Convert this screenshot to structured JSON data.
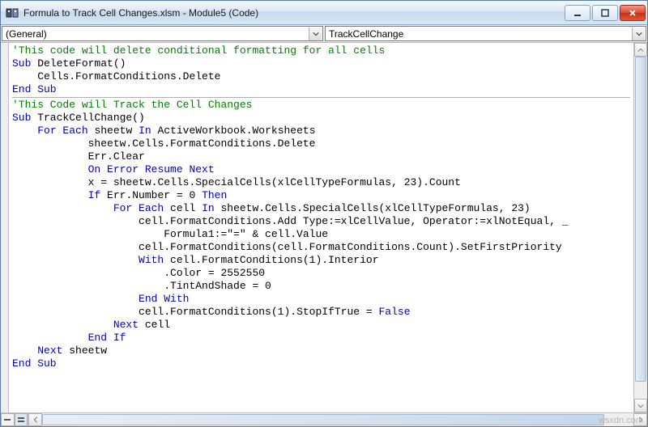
{
  "window": {
    "title": "Formula to Track Cell Changes.xlsm - Module5 (Code)"
  },
  "dropdowns": {
    "left": "(General)",
    "right": "TrackCellChange"
  },
  "code": {
    "lines": [
      {
        "indent": 0,
        "segs": [
          {
            "t": "'This code will delete conditional formatting for all cells",
            "c": "c-comment"
          }
        ]
      },
      {
        "indent": 0,
        "segs": [
          {
            "t": "Sub",
            "c": "c-keyword"
          },
          {
            "t": " DeleteFormat()"
          }
        ]
      },
      {
        "indent": 1,
        "segs": [
          {
            "t": "Cells.FormatConditions.Delete"
          }
        ]
      },
      {
        "indent": 0,
        "segs": [
          {
            "t": "End Sub",
            "c": "c-keyword"
          }
        ]
      },
      {
        "rule": true
      },
      {
        "indent": 0,
        "segs": [
          {
            "t": "'This Code will Track the Cell Changes",
            "c": "c-comment"
          }
        ]
      },
      {
        "indent": 0,
        "segs": [
          {
            "t": "Sub",
            "c": "c-keyword"
          },
          {
            "t": " TrackCellChange()"
          }
        ]
      },
      {
        "indent": 1,
        "segs": [
          {
            "t": "For Each",
            "c": "c-keyword"
          },
          {
            "t": " sheetw "
          },
          {
            "t": "In",
            "c": "c-keyword"
          },
          {
            "t": " ActiveWorkbook.Worksheets"
          }
        ]
      },
      {
        "indent": 3,
        "segs": [
          {
            "t": "sheetw.Cells.FormatConditions.Delete"
          }
        ]
      },
      {
        "indent": 3,
        "segs": [
          {
            "t": "Err.Clear"
          }
        ]
      },
      {
        "indent": 3,
        "segs": [
          {
            "t": "On Error Resume Next",
            "c": "c-keyword"
          }
        ]
      },
      {
        "indent": 3,
        "segs": [
          {
            "t": "x = sheetw.Cells.SpecialCells(xlCellTypeFormulas, 23).Count"
          }
        ]
      },
      {
        "indent": 3,
        "segs": [
          {
            "t": "If",
            "c": "c-keyword"
          },
          {
            "t": " Err.Number = 0 "
          },
          {
            "t": "Then",
            "c": "c-keyword"
          }
        ]
      },
      {
        "indent": 4,
        "segs": [
          {
            "t": "For Each",
            "c": "c-keyword"
          },
          {
            "t": " cell "
          },
          {
            "t": "In",
            "c": "c-keyword"
          },
          {
            "t": " sheetw.Cells.SpecialCells(xlCellTypeFormulas, 23)"
          }
        ]
      },
      {
        "indent": 5,
        "segs": [
          {
            "t": "cell.FormatConditions.Add Type:=xlCellValue, Operator:=xlNotEqual, _"
          }
        ]
      },
      {
        "indent": 6,
        "segs": [
          {
            "t": "Formula1:=\"=\" & cell.Value"
          }
        ]
      },
      {
        "indent": 5,
        "segs": [
          {
            "t": "cell.FormatConditions(cell.FormatConditions.Count).SetFirstPriority"
          }
        ]
      },
      {
        "indent": 5,
        "segs": [
          {
            "t": "With",
            "c": "c-keyword"
          },
          {
            "t": " cell.FormatConditions(1).Interior"
          }
        ]
      },
      {
        "indent": 6,
        "segs": [
          {
            "t": ".Color = 2552550"
          }
        ]
      },
      {
        "indent": 6,
        "segs": [
          {
            "t": ".TintAndShade = 0"
          }
        ]
      },
      {
        "indent": 5,
        "segs": [
          {
            "t": "End With",
            "c": "c-keyword"
          }
        ]
      },
      {
        "indent": 5,
        "segs": [
          {
            "t": "cell.FormatConditions(1).StopIfTrue = "
          },
          {
            "t": "False",
            "c": "c-keyword"
          }
        ]
      },
      {
        "indent": 4,
        "segs": [
          {
            "t": "Next",
            "c": "c-keyword"
          },
          {
            "t": " cell"
          }
        ]
      },
      {
        "indent": 3,
        "segs": [
          {
            "t": "End If",
            "c": "c-keyword"
          }
        ]
      },
      {
        "indent": 0,
        "segs": [
          {
            "t": ""
          }
        ]
      },
      {
        "indent": 1,
        "segs": [
          {
            "t": "Next",
            "c": "c-keyword"
          },
          {
            "t": " sheetw"
          }
        ]
      },
      {
        "indent": 0,
        "segs": [
          {
            "t": "End Sub",
            "c": "c-keyword"
          }
        ]
      }
    ]
  },
  "watermark": "wsxdn.com"
}
